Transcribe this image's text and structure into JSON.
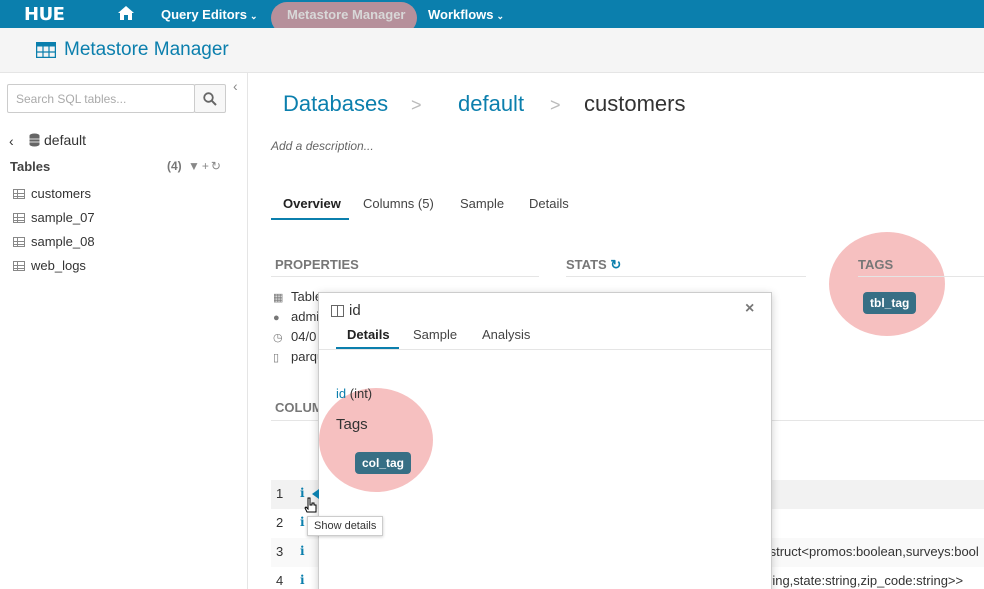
{
  "topnav": {
    "logo": "HUE",
    "items": [
      {
        "label": "Query Editors",
        "chevron": "⌄"
      },
      {
        "label": "Metastore Manager"
      },
      {
        "label": "Workflows",
        "chevron": "⌄"
      }
    ]
  },
  "header": {
    "title": "Metastore Manager"
  },
  "sidebar": {
    "search_placeholder": "Search SQL tables...",
    "database": "default",
    "tables_label": "Tables",
    "tables_count": "(4)",
    "tables": [
      "customers",
      "sample_07",
      "sample_08",
      "web_logs"
    ]
  },
  "breadcrumb": {
    "databases": "Databases",
    "sep": ">",
    "database": "default",
    "table": "customers"
  },
  "description_placeholder": "Add a description...",
  "tabs": [
    "Overview",
    "Columns (5)",
    "Sample",
    "Details"
  ],
  "sections": {
    "properties": "PROPERTIES",
    "stats": "STATS",
    "tags": "TAGS",
    "columns": "COLUM"
  },
  "properties": [
    "Table",
    "admi",
    "04/0",
    "parqu"
  ],
  "table_tag": "tbl_tag",
  "rows": [
    {
      "num": "1",
      "info": "i",
      "type": ""
    },
    {
      "num": "2",
      "info": "i",
      "type": ""
    },
    {
      "num": "3",
      "info": "i",
      "type": ":struct<promos:boolean,surveys:bool"
    },
    {
      "num": "4",
      "info": "i",
      "type": "ring,state:string,zip_code:string>>"
    }
  ],
  "popover": {
    "title": "id",
    "tabs": [
      "Details",
      "Sample",
      "Analysis"
    ],
    "field_name": "id",
    "field_type": "(int)",
    "tags_label": "Tags",
    "col_tag": "col_tag",
    "close": "×"
  },
  "tooltip": "Show details",
  "colors": {
    "brand": "#0B7FAD",
    "tag": "#376F85",
    "highlight": "#F09696"
  }
}
